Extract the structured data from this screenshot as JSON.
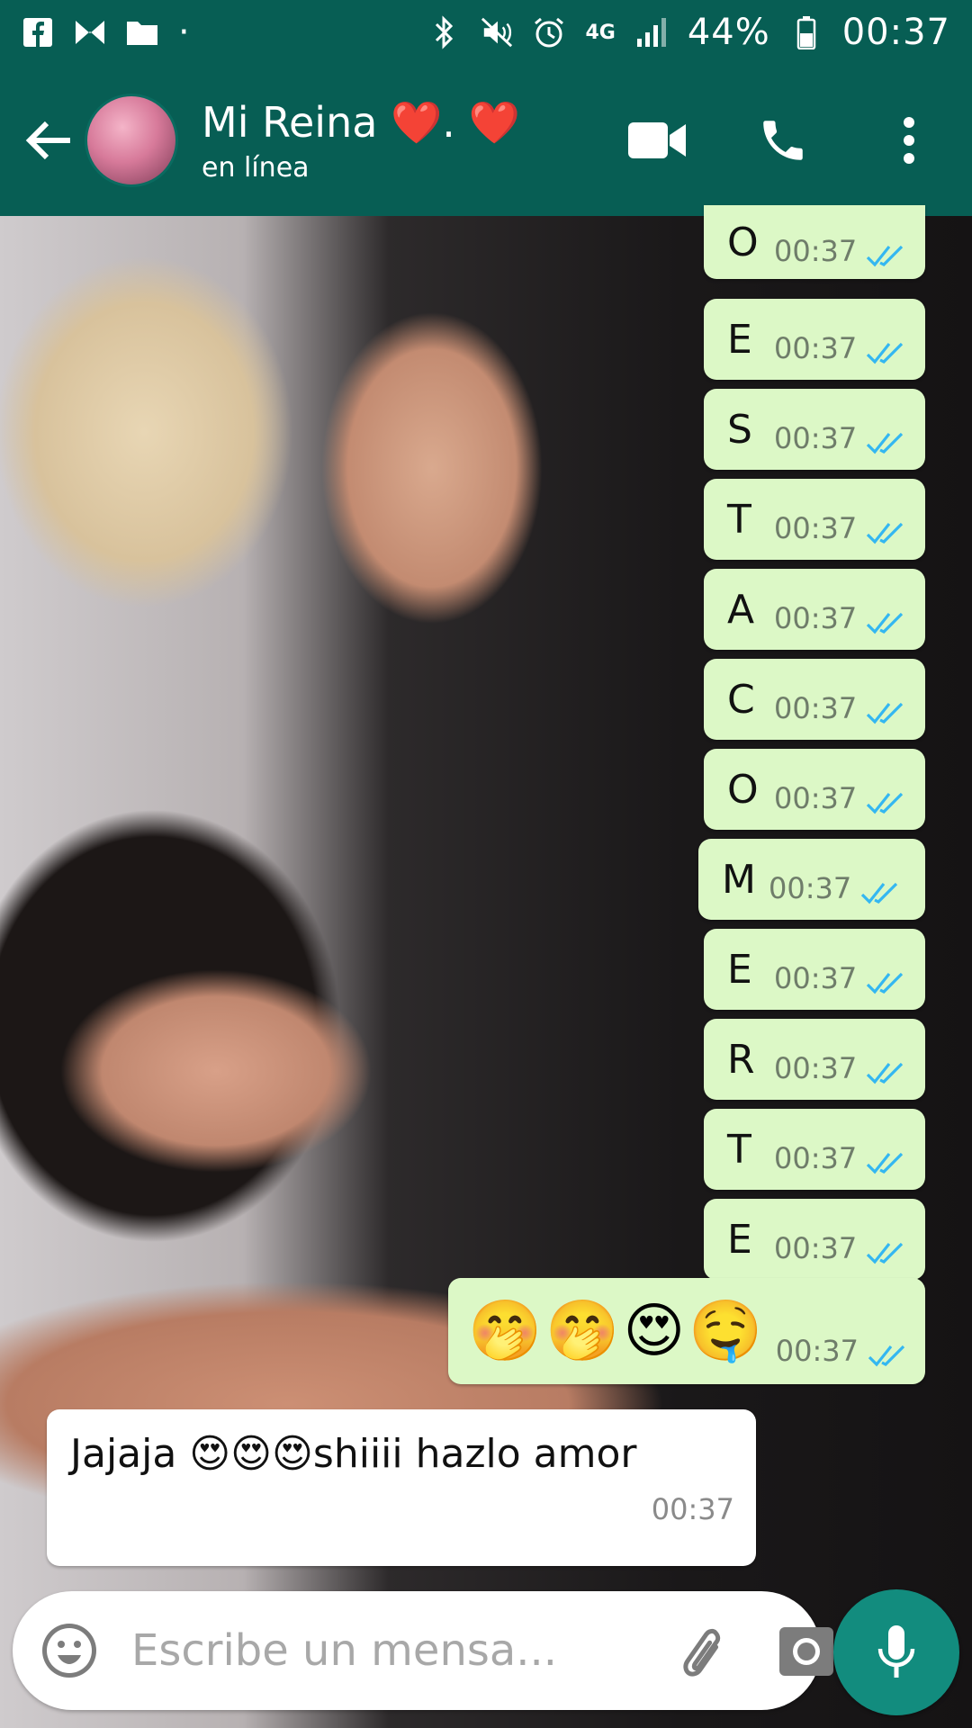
{
  "status_bar": {
    "network": "4G",
    "battery": "44%",
    "time": "00:37",
    "dot": "·"
  },
  "header": {
    "contact_name": "Mi Reina ❤️. ❤️",
    "contact_status": "en línea"
  },
  "messages": [
    {
      "text": "O",
      "time": "00:37"
    },
    {
      "text": "E",
      "time": "00:37"
    },
    {
      "text": "S",
      "time": "00:37"
    },
    {
      "text": "T",
      "time": "00:37"
    },
    {
      "text": "A",
      "time": "00:37"
    },
    {
      "text": "C",
      "time": "00:37"
    },
    {
      "text": "O",
      "time": "00:37"
    },
    {
      "text": "M",
      "time": "00:37"
    },
    {
      "text": "E",
      "time": "00:37"
    },
    {
      "text": "R",
      "time": "00:37"
    },
    {
      "text": "T",
      "time": "00:37"
    },
    {
      "text": "E",
      "time": "00:37"
    }
  ],
  "emoji_message": {
    "text": "🤭🤭😍🤤",
    "time": "00:37"
  },
  "incoming_message": {
    "text": "Jajaja 😍😍😍shiiii hazlo amor",
    "time": "00:37"
  },
  "input": {
    "placeholder": "Escribe un mensa..."
  },
  "colors": {
    "header": "#075e54",
    "outgoing_bubble": "#dcf8c6",
    "incoming_bubble": "#ffffff",
    "read_check": "#34b7f1",
    "mic_button": "#128c7e"
  }
}
